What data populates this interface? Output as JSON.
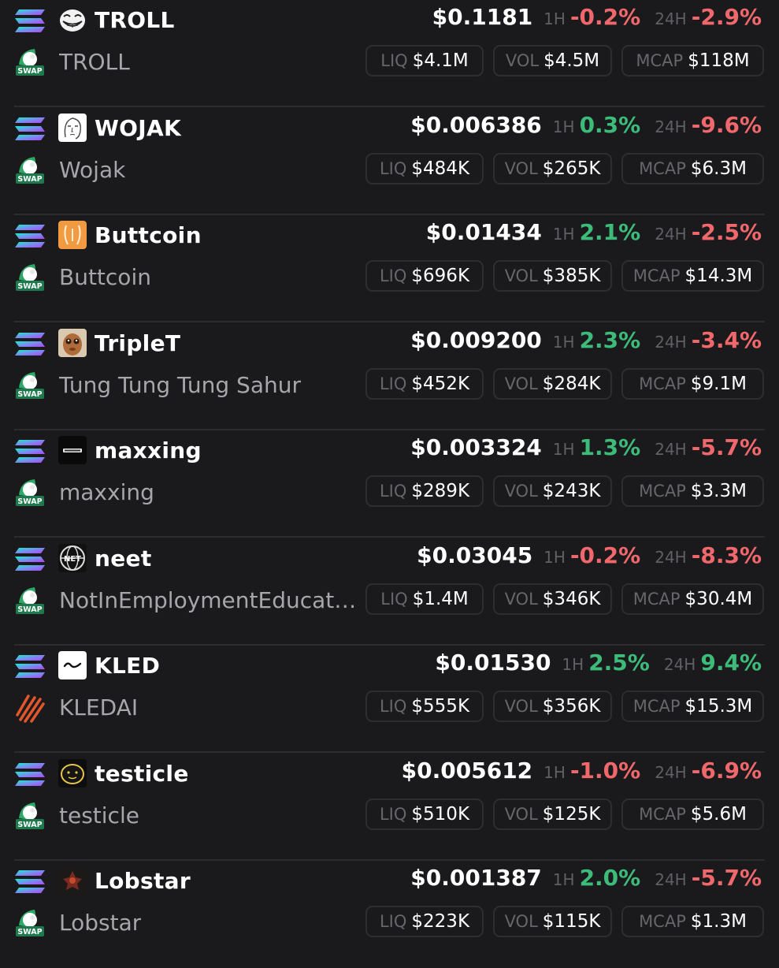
{
  "rows": [
    {
      "symbol": "TROLL",
      "name": "TROLL",
      "price": "$0.1181",
      "h1_label": "1H",
      "h1": "-0.2%",
      "h24_label": "24H",
      "h24": "-2.9%",
      "liq_label": "LIQ",
      "liq": "$4.1M",
      "vol_label": "VOL",
      "vol": "$4.5M",
      "mcap_label": "MCAP",
      "mcap": "$118M",
      "avatar": "troll-face-icon",
      "dex": "swap"
    },
    {
      "symbol": "WOJAK",
      "name": "Wojak",
      "price": "$0.006386",
      "h1_label": "1H",
      "h1": "0.3%",
      "h24_label": "24H",
      "h24": "-9.6%",
      "liq_label": "LIQ",
      "liq": "$484K",
      "vol_label": "VOL",
      "vol": "$265K",
      "mcap_label": "MCAP",
      "mcap": "$6.3M",
      "avatar": "wojak-face-icon",
      "dex": "swap"
    },
    {
      "symbol": "Buttcoin",
      "name": "Buttcoin",
      "price": "$0.01434",
      "h1_label": "1H",
      "h1": "2.1%",
      "h24_label": "24H",
      "h24": "-2.5%",
      "liq_label": "LIQ",
      "liq": "$696K",
      "vol_label": "VOL",
      "vol": "$385K",
      "mcap_label": "MCAP",
      "mcap": "$14.3M",
      "avatar": "buttcoin-icon",
      "dex": "swap"
    },
    {
      "symbol": "TripleT",
      "name": "Tung Tung Tung Sahur",
      "price": "$0.009200",
      "h1_label": "1H",
      "h1": "2.3%",
      "h24_label": "24H",
      "h24": "-3.4%",
      "liq_label": "LIQ",
      "liq": "$452K",
      "vol_label": "VOL",
      "vol": "$284K",
      "mcap_label": "MCAP",
      "mcap": "$9.1M",
      "avatar": "triplet-face-icon",
      "dex": "swap"
    },
    {
      "symbol": "maxxing",
      "name": "maxxing",
      "price": "$0.003324",
      "h1_label": "1H",
      "h1": "1.3%",
      "h24_label": "24H",
      "h24": "-5.7%",
      "liq_label": "LIQ",
      "liq": "$289K",
      "vol_label": "VOL",
      "vol": "$243K",
      "mcap_label": "MCAP",
      "mcap": "$3.3M",
      "avatar": "maxxing-logo-icon",
      "dex": "swap"
    },
    {
      "symbol": "neet",
      "name": "NotInEmploymentEducat…",
      "price": "$0.03045",
      "h1_label": "1H",
      "h1": "-0.2%",
      "h24_label": "24H",
      "h24": "-8.3%",
      "liq_label": "LIQ",
      "liq": "$1.4M",
      "vol_label": "VOL",
      "vol": "$346K",
      "mcap_label": "MCAP",
      "mcap": "$30.4M",
      "avatar": "neet-globe-icon",
      "dex": "swap"
    },
    {
      "symbol": "KLED",
      "name": "KLEDAI",
      "price": "$0.01530",
      "h1_label": "1H",
      "h1": "2.5%",
      "h24_label": "24H",
      "h24": "9.4%",
      "liq_label": "LIQ",
      "liq": "$555K",
      "vol_label": "VOL",
      "vol": "$356K",
      "mcap_label": "MCAP",
      "mcap": "$15.3M",
      "avatar": "kled-wave-icon",
      "dex": "kled"
    },
    {
      "symbol": "testicle",
      "name": "testicle",
      "price": "$0.005612",
      "h1_label": "1H",
      "h1": "-1.0%",
      "h24_label": "24H",
      "h24": "-6.9%",
      "liq_label": "LIQ",
      "liq": "$510K",
      "vol_label": "VOL",
      "vol": "$125K",
      "mcap_label": "MCAP",
      "mcap": "$5.6M",
      "avatar": "testicle-face-icon",
      "dex": "swap"
    },
    {
      "symbol": "Lobstar",
      "name": "Lobstar",
      "price": "$0.001387",
      "h1_label": "1H",
      "h1": "2.0%",
      "h24_label": "24H",
      "h24": "-5.7%",
      "liq_label": "LIQ",
      "liq": "$223K",
      "vol_label": "VOL",
      "vol": "$115K",
      "mcap_label": "MCAP",
      "mcap": "$1.3M",
      "avatar": "lobstar-icon",
      "dex": "swap"
    }
  ],
  "colors": {
    "positive": "#3dbb78",
    "negative": "#f0686b",
    "background": "#1a1a1d"
  },
  "icons": {
    "chain": "solana-icon",
    "swap": "swap-dex-icon",
    "kled": "kled-dex-icon"
  },
  "swap_badge": "SWAP"
}
